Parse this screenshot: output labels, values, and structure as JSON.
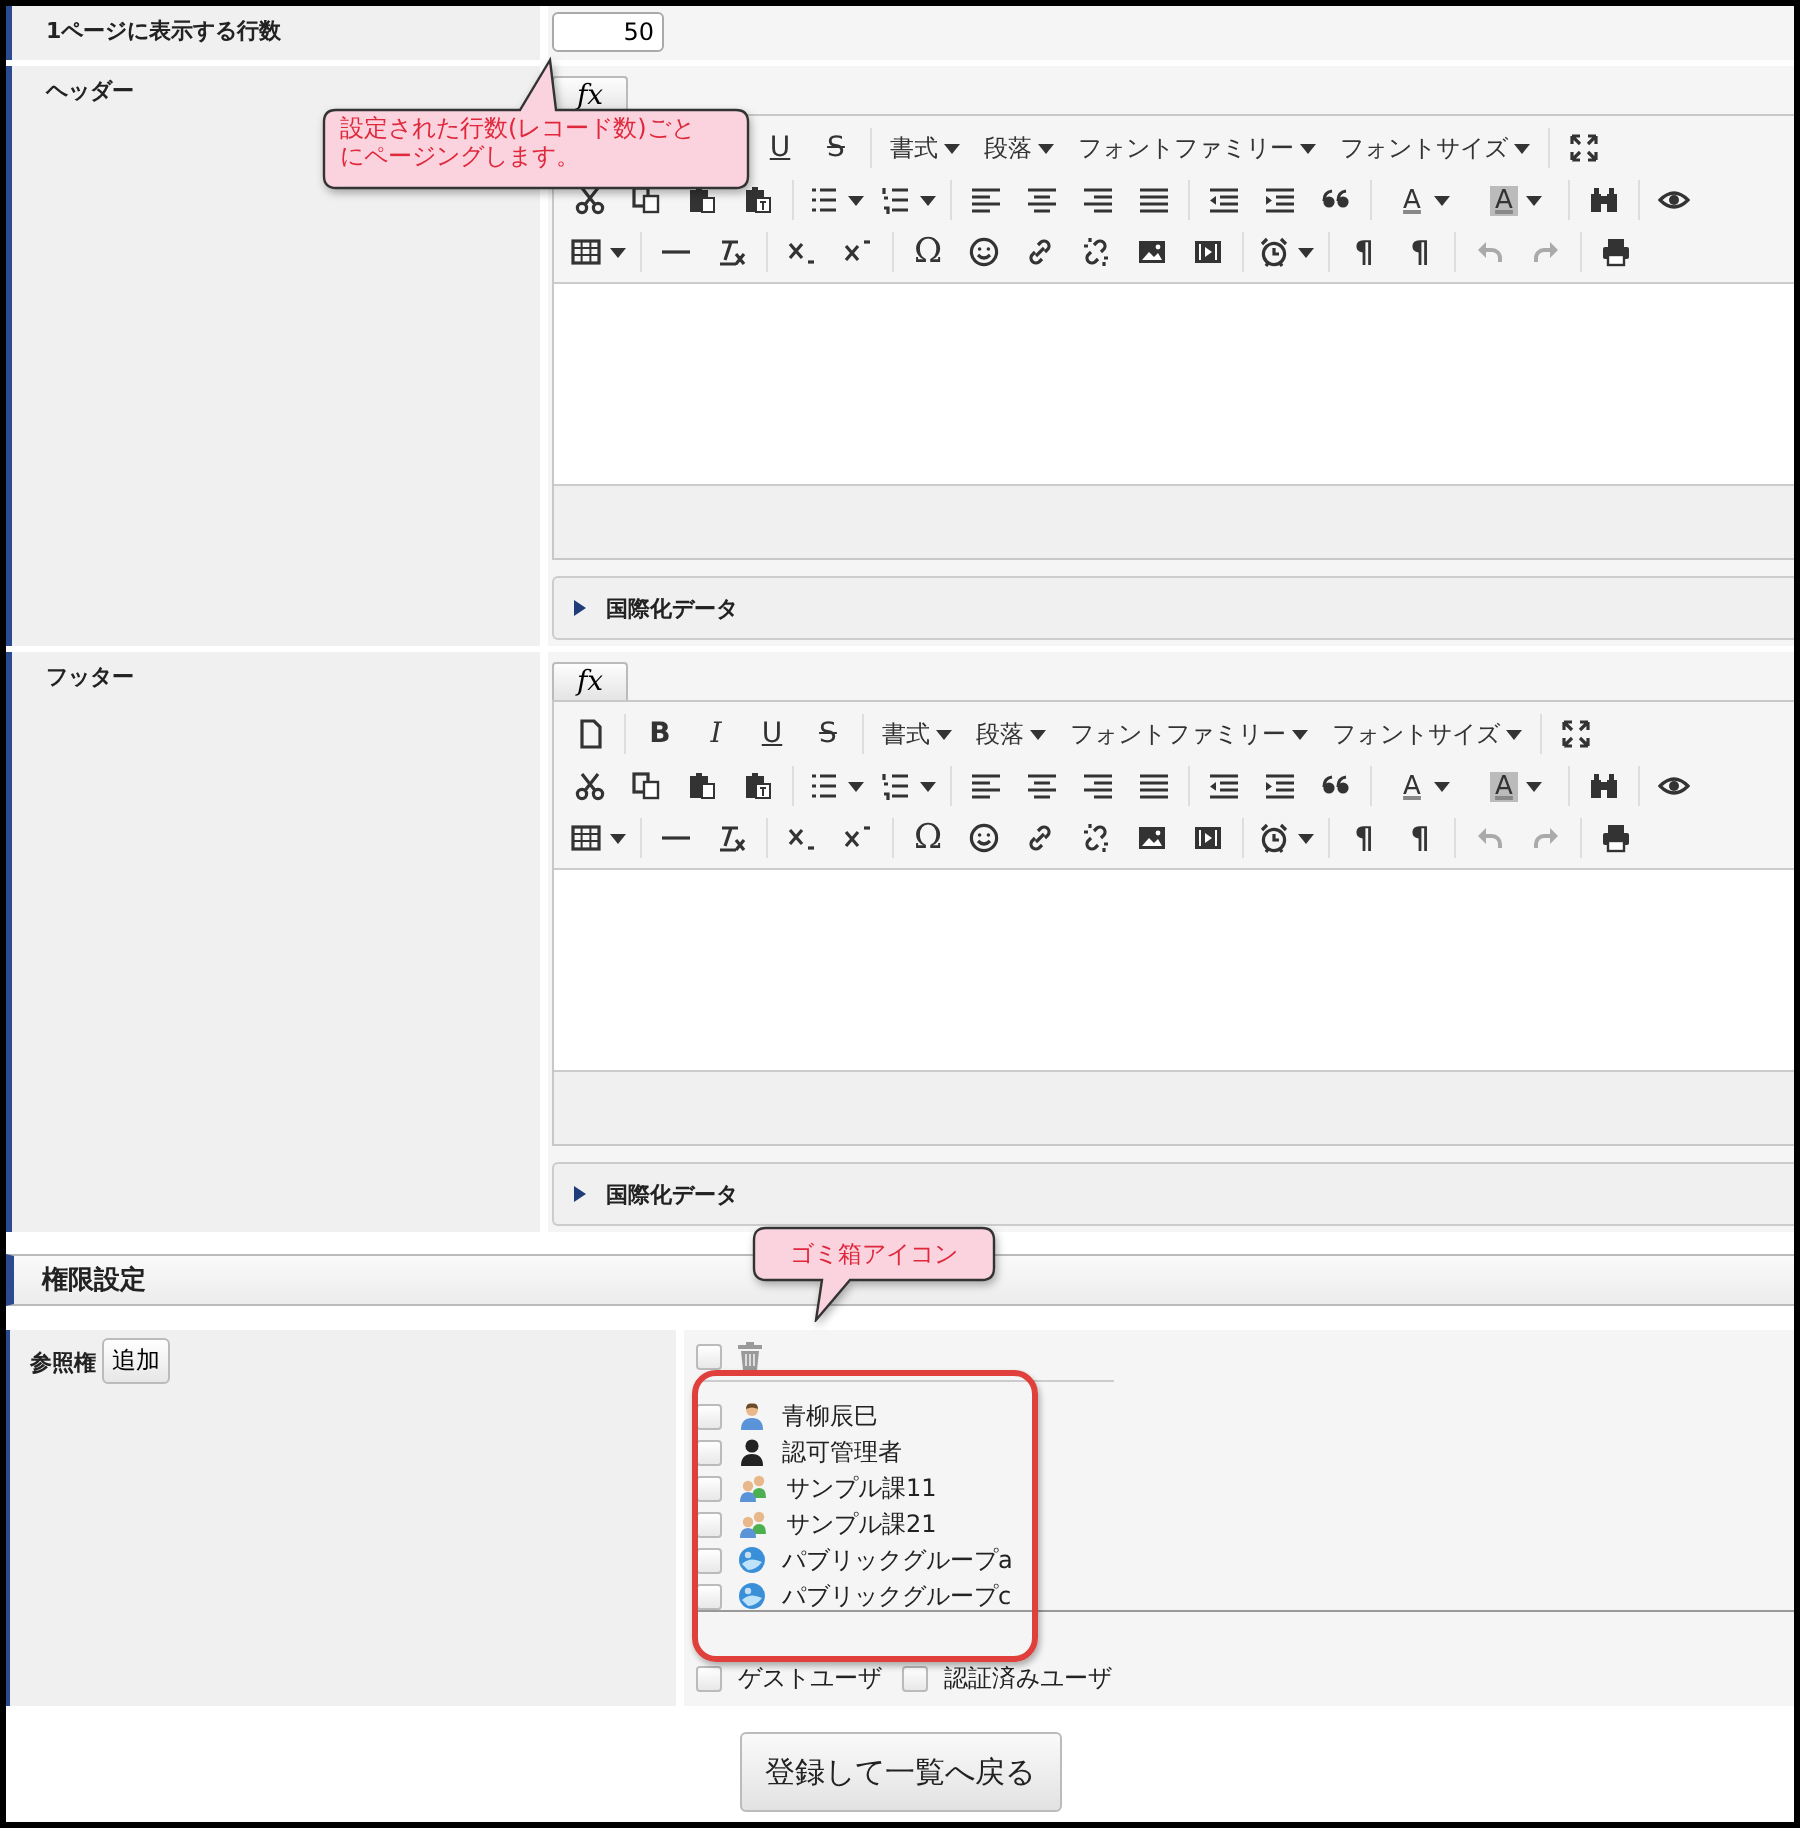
{
  "page_size_row": {
    "label": "1ページに表示する行数",
    "value": "50"
  },
  "editors": [
    {
      "label": "ヘッダー",
      "fx": "fx",
      "leading_covered": true,
      "style_buttons": [
        {
          "kind": "underline",
          "text": "U"
        },
        {
          "kind": "strike",
          "text": "S"
        }
      ],
      "menus": [
        "書式",
        "段落",
        "フォントファミリー",
        "フォントサイズ"
      ],
      "text_color": "A",
      "bg_color": "A",
      "omega": "Ω",
      "pilcrow": "¶",
      "i18n": {
        "label": "国際化データ",
        "expanded": false
      }
    },
    {
      "label": "フッター",
      "fx": "fx",
      "leading_covered": false,
      "style_buttons": [
        {
          "kind": "bold",
          "text": "B"
        },
        {
          "kind": "italic",
          "text": "I"
        },
        {
          "kind": "underline",
          "text": "U"
        },
        {
          "kind": "strike",
          "text": "S"
        }
      ],
      "menus": [
        "書式",
        "段落",
        "フォントファミリー",
        "フォントサイズ"
      ],
      "text_color": "A",
      "bg_color": "A",
      "omega": "Ω",
      "pilcrow": "¶",
      "i18n": {
        "label": "国際化データ",
        "expanded": false
      }
    }
  ],
  "section": {
    "title": "権限設定"
  },
  "permission": {
    "label": "参照権",
    "add_button": "追加",
    "select_all_checked": false,
    "entries": [
      {
        "name": "青柳辰巳",
        "kind": "user",
        "checked": false
      },
      {
        "name": "認可管理者",
        "kind": "admin",
        "checked": false
      },
      {
        "name": "サンプル課11",
        "kind": "group",
        "checked": false
      },
      {
        "name": "サンプル課21",
        "kind": "group",
        "checked": false
      },
      {
        "name": "パブリックグループa",
        "kind": "public",
        "checked": false
      },
      {
        "name": "パブリックグループc",
        "kind": "public",
        "checked": false
      }
    ],
    "public_options": [
      {
        "label": "ゲストユーザ",
        "checked": false
      },
      {
        "label": "認証済みユーザ",
        "checked": false
      }
    ]
  },
  "submit_button": "登録して一覧へ戻る",
  "callouts": [
    {
      "text": "設定された行数(レコード数)ごとにページングします。"
    },
    {
      "text": "ゴミ箱アイコン"
    }
  ]
}
